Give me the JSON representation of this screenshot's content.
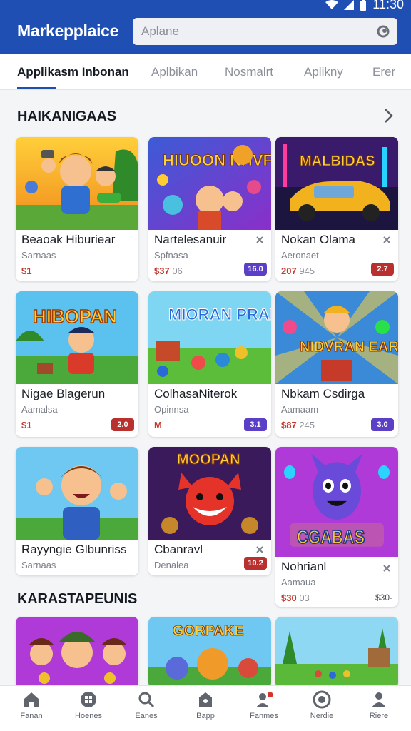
{
  "status_bar": {
    "time": "11:30",
    "icons": [
      "wifi-icon",
      "signal-icon",
      "battery-icon"
    ]
  },
  "app_bar": {
    "title": "Markepplaice",
    "search_placeholder": "Aplane"
  },
  "tabs": [
    {
      "label": "Applikasm Inbonan",
      "active": true
    },
    {
      "label": "Aplbikan",
      "active": false
    },
    {
      "label": "Nosmalrt",
      "active": false
    },
    {
      "label": "Aplikny",
      "active": false
    },
    {
      "label": "Erer",
      "active": false
    }
  ],
  "sections": [
    {
      "title": "HAIKANIGAAS"
    },
    {
      "title": "KARASTAPEUNIS"
    }
  ],
  "cards": [
    {
      "title": "Beaoak Hiburiear",
      "subtitle": "Sarnaas",
      "price": "$1",
      "price_extra": "",
      "badge": "",
      "image": "cartoon-hero-game-art"
    },
    {
      "title": "Nartelesanuir",
      "subtitle": "Spfnasa",
      "price": "$37",
      "price_extra": "06",
      "badge": "16.0",
      "image": "monster-adventure-game-art",
      "image_text": "HIUOON NHVFBR"
    },
    {
      "title": "Nokan Olama",
      "subtitle": "Aeronaet",
      "price": "207",
      "price_extra": "945",
      "badge": "2.7",
      "image": "racing-car-game-art",
      "image_text": "MALBIDAS"
    },
    {
      "title": "Nigae Blagerun",
      "subtitle": "Aamalsa",
      "price": "$1",
      "price_extra": "",
      "badge": "2.0",
      "image": "hibopan-adventure-game-art",
      "image_text": "HIBOPAN"
    },
    {
      "title": "ColhasaNiterok",
      "subtitle": "Opinnsa",
      "price": "M",
      "price_extra": "",
      "badge": "3.1",
      "image": "mioran-puzzle-game-art",
      "image_text": "MIORAN PRABIO"
    },
    {
      "title": "Nbkam Csdirga",
      "subtitle": "Aamaam",
      "price": "$87",
      "price_extra": "245",
      "badge": "3.0",
      "image": "nidvran-arcade-game-art",
      "image_text": "NIDVRAN EARS"
    },
    {
      "title": "Rayyngie Glbunriss",
      "subtitle": "Sarnaas",
      "price": "",
      "price_extra": "",
      "badge": "",
      "image": "cartoon-boy-game-art"
    },
    {
      "title": "Cbanravl",
      "subtitle": "Denalea",
      "price": "",
      "price_extra": "",
      "badge": "10.2",
      "image": "moopan-red-fox-game-art",
      "image_text": "MOOPAN"
    },
    {
      "title": "Nohrianl",
      "subtitle": "Aamaua",
      "price": "$30",
      "price_extra": "03",
      "badge": "",
      "side_count": "$30-",
      "image": "cgabas-monster-game-art",
      "image_text": "CGABAS"
    },
    {
      "title": "",
      "subtitle": "",
      "price": "",
      "badge": "",
      "image": "pirate-kids-game-art"
    },
    {
      "title": "",
      "subtitle": "",
      "price": "",
      "badge": "",
      "image": "gorpake-animal-game-art",
      "image_text": "GORPAKE"
    },
    {
      "title": "",
      "subtitle": "",
      "price": "",
      "badge": "",
      "image": "jungle-village-game-art"
    }
  ],
  "bottom_nav": [
    {
      "label": "Fanan",
      "icon": "home-icon"
    },
    {
      "label": "Hoenes",
      "icon": "grid-icon"
    },
    {
      "label": "Eanes",
      "icon": "search-icon"
    },
    {
      "label": "Bapp",
      "icon": "store-icon"
    },
    {
      "label": "Fanmes",
      "icon": "people-icon"
    },
    {
      "label": "Nerdie",
      "icon": "check-circle-icon"
    },
    {
      "label": "Riere",
      "icon": "profile-icon"
    }
  ],
  "colors": {
    "primary": "#1f4fb2",
    "price": "#c23a2e",
    "badge": "#b8312f"
  }
}
